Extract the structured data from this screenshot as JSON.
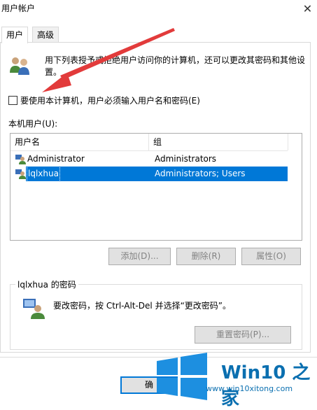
{
  "window": {
    "title": "用户帐户",
    "close_glyph": "✕"
  },
  "tabs": [
    {
      "label": "用户",
      "active": true
    },
    {
      "label": "高级",
      "active": false
    }
  ],
  "intro": {
    "icon": "users-icon",
    "text": "用下列表授予或拒绝用户访问你的计算机，还可以更改其密码和其他设置。"
  },
  "require_password": {
    "checked": false,
    "label": "要使用本计算机，用户必须输入用户名和密码(E)"
  },
  "local_users": {
    "label": "本机用户(U):",
    "columns": [
      "用户名",
      "组"
    ],
    "rows": [
      {
        "name": "Administrator",
        "group": "Administrators",
        "selected": false
      },
      {
        "name": "lqlxhua",
        "group": "Administrators; Users",
        "selected": true
      }
    ]
  },
  "user_buttons": {
    "add": "添加(D)...",
    "remove": "删除(R)",
    "properties": "属性(O)"
  },
  "password_group": {
    "title": "lqlxhua 的密码",
    "text": "要改密码，按 Ctrl-Alt-Del 并选择“更改密码”。",
    "reset_button": "重置密码(P)..."
  },
  "footer": {
    "ok_label": "确"
  },
  "watermark": {
    "brand": "Win10 之家",
    "url": "www.win10xitong.com"
  },
  "colors": {
    "selection": "#0078d7",
    "annotation_arrow": "#e23b3b",
    "brand_blue": "#0a6fb0"
  }
}
